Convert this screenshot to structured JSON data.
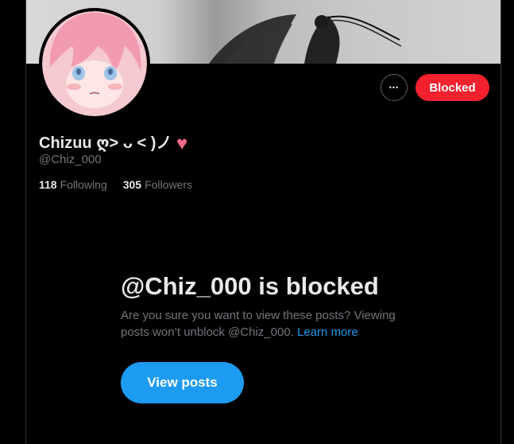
{
  "profile": {
    "name": "Chizuu ღ˃ ᴗ ˂ )ノ",
    "heart": "♥",
    "handle": "@Chiz_000",
    "following_count": "118",
    "following_label": "Following",
    "followers_count": "305",
    "followers_label": "Followers"
  },
  "actions": {
    "more_label": "•••",
    "blocked_label": "Blocked"
  },
  "blocked_notice": {
    "title": "@Chiz_000 is blocked",
    "description": "Are you sure you want to view these posts? Viewing posts won’t unblock @Chiz_000.",
    "learn_more": "Learn more",
    "view_button": "View posts"
  },
  "colors": {
    "accent": "#1d9bf0",
    "blocked": "#f4212e",
    "background": "#000000",
    "secondary_text": "#71767b",
    "heart": "#f06a88"
  },
  "icons": {
    "more": "more-horizontal-icon",
    "heart": "heart-emoji-icon"
  }
}
